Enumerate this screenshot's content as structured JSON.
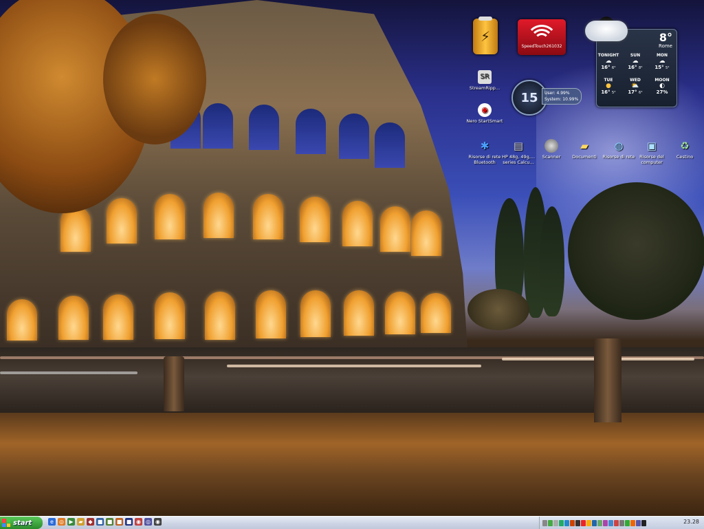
{
  "gadgets": {
    "battery": {
      "icon": "battery-charging-icon"
    },
    "wifi": {
      "ssid": "SpeedTouch261032",
      "icon": "wifi-signal-icon"
    },
    "clock": {
      "value": "15"
    },
    "cpu": {
      "user": "User: 4.99%",
      "system": "System: 10.99%"
    },
    "weather": {
      "temp": "8°",
      "city": "Rome",
      "forecast": [
        {
          "name": "TONIGHT",
          "high": "16°",
          "low": "6°",
          "icon": "cloud-rain-icon"
        },
        {
          "name": "SUN",
          "high": "16°",
          "low": "8°",
          "icon": "cloud-rain-icon"
        },
        {
          "name": "MON",
          "high": "15°",
          "low": "5°",
          "icon": "cloud-rain-icon"
        },
        {
          "name": "TUE",
          "high": "16°",
          "low": "5°",
          "icon": "sun-icon"
        },
        {
          "name": "WED",
          "high": "17°",
          "low": "6°",
          "icon": "partly-cloudy-icon"
        },
        {
          "name": "MOON",
          "high": "27%",
          "low": "",
          "icon": "moon-phase-icon"
        }
      ]
    }
  },
  "desktop_icons": [
    {
      "label": "StreamRipp...",
      "icon": "streamripper-icon"
    },
    {
      "label": "Nero StartSmart",
      "icon": "nero-icon"
    },
    {
      "label": "Risorse di rete Bluetooth",
      "icon": "bluetooth-icon"
    },
    {
      "label": "HP 48g, 49g,... series Calcu...",
      "icon": "calculator-icon"
    },
    {
      "label": "Scanner",
      "icon": "scanner-icon"
    },
    {
      "label": "Documenti",
      "icon": "documents-folder-icon"
    },
    {
      "label": "Risorse di rete",
      "icon": "network-places-icon"
    },
    {
      "label": "Risorse del computer",
      "icon": "my-computer-icon"
    },
    {
      "label": "Cestino",
      "icon": "recycle-bin-icon"
    }
  ],
  "taskbar": {
    "start_label": "start",
    "quick_launch": [
      "ie-icon",
      "firefox-icon",
      "media-icon",
      "folder-icon",
      "app-icon",
      "app-icon",
      "app-icon",
      "app-icon",
      "app-icon",
      "app-icon",
      "app-icon",
      "app-icon"
    ],
    "clock": "23.28"
  },
  "colors": {
    "start_green": "#2a8a2a",
    "taskbar": "#cfd6e6",
    "wifi_red": "#e01a2a",
    "battery_gold": "#ffc440"
  }
}
